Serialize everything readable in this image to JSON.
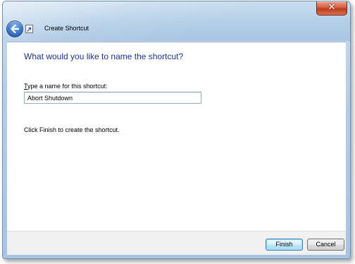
{
  "window": {
    "title": "Create Shortcut",
    "close_glyph": "✕"
  },
  "icons": {
    "back": "back-arrow-icon",
    "shortcut": "shortcut-arrow-icon",
    "close": "close-icon"
  },
  "content": {
    "heading": "What would you like to name the shortcut?",
    "field_label_accel": "T",
    "field_label_rest": "ype a name for this shortcut:",
    "name_value": "Abort Shutdown",
    "instruction": "Click Finish to create the shortcut."
  },
  "footer": {
    "finish_label": "Finish",
    "cancel_label": "Cancel"
  },
  "colors": {
    "heading": "#1e3287",
    "titlebar": "#b5cfe8",
    "close_button": "#c0391c",
    "default_button_border": "#3c7fb1"
  }
}
